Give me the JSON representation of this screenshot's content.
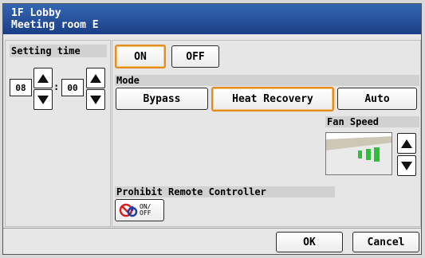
{
  "title": {
    "line1": "1F Lobby",
    "line2": "Meeting room E"
  },
  "setting_time": {
    "label": "Setting time",
    "hours": "08",
    "separator": ":",
    "minutes": "00"
  },
  "power": {
    "on_label": "ON",
    "off_label": "OFF",
    "selected": "ON"
  },
  "mode": {
    "label": "Mode",
    "options": [
      "Bypass",
      "Heat Recovery",
      "Auto"
    ],
    "selected": "Heat Recovery"
  },
  "fan_speed": {
    "label": "Fan Speed"
  },
  "prohibit": {
    "label": "Prohibit Remote Controller",
    "button_text_line1": "ON/",
    "button_text_line2": "OFF"
  },
  "footer": {
    "ok_label": "OK",
    "cancel_label": "Cancel"
  },
  "colors": {
    "title_bar": "#2a55a3",
    "selected_border": "#e48d1d",
    "fan_bars": "#2fbf3a"
  }
}
